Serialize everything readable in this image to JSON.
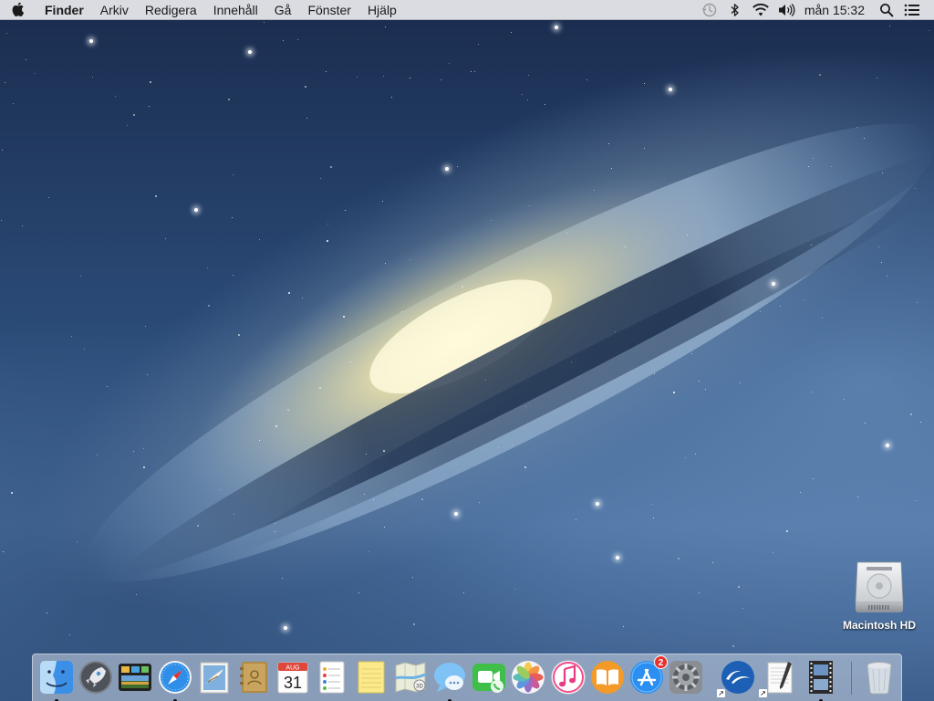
{
  "menubar": {
    "apple_icon": "apple-icon",
    "items": [
      "Finder",
      "Arkiv",
      "Redigera",
      "Innehåll",
      "Gå",
      "Fönster",
      "Hjälp"
    ],
    "status_icons": [
      "time-machine-icon",
      "bluetooth-icon",
      "wifi-icon",
      "volume-icon"
    ],
    "clock": "mån 15:32",
    "spotlight_icon": "search-icon",
    "notification_icon": "notification-center-icon"
  },
  "desktop": {
    "icons": [
      {
        "label": "Macintosh HD",
        "icon": "hard-drive-icon"
      }
    ]
  },
  "dock": {
    "apps": [
      {
        "name": "Finder",
        "icon": "finder-icon",
        "running": true
      },
      {
        "name": "Launchpad",
        "icon": "launchpad-icon",
        "running": false
      },
      {
        "name": "Mission Control",
        "icon": "mission-control-icon",
        "running": false
      },
      {
        "name": "Safari",
        "icon": "safari-icon",
        "running": true
      },
      {
        "name": "Mail",
        "icon": "mail-icon",
        "running": false
      },
      {
        "name": "Kontakter",
        "icon": "contacts-icon",
        "running": false
      },
      {
        "name": "Kalender",
        "icon": "calendar-icon",
        "running": false,
        "month": "AUG",
        "day": "31"
      },
      {
        "name": "Påminnelser",
        "icon": "reminders-icon",
        "running": false
      },
      {
        "name": "Anteckningar",
        "icon": "notes-icon",
        "running": false
      },
      {
        "name": "Kartor",
        "icon": "maps-icon",
        "running": false
      },
      {
        "name": "Meddelanden",
        "icon": "messages-icon",
        "running": true
      },
      {
        "name": "FaceTime",
        "icon": "facetime-icon",
        "running": false
      },
      {
        "name": "Bilder",
        "icon": "photos-icon",
        "running": false
      },
      {
        "name": "iTunes",
        "icon": "itunes-icon",
        "running": false
      },
      {
        "name": "iBooks",
        "icon": "ibooks-icon",
        "running": false
      },
      {
        "name": "App Store",
        "icon": "app-store-icon",
        "running": false,
        "badge": "2"
      },
      {
        "name": "Systeminställningar",
        "icon": "system-preferences-icon",
        "running": false
      },
      {
        "name": "OpenOffice",
        "icon": "openoffice-icon",
        "running": false
      },
      {
        "name": "TextEdit",
        "icon": "textedit-icon",
        "running": false
      },
      {
        "name": "Film",
        "icon": "film-icon",
        "running": true
      },
      {
        "name": "Papperskorg",
        "icon": "trash-icon",
        "running": false
      }
    ]
  },
  "colors": {
    "menubar_bg": "#ececee",
    "badge_red": "#e8302c",
    "wallpaper_dark": "#1a2c4e",
    "wallpaper_light": "#4c72a2"
  }
}
